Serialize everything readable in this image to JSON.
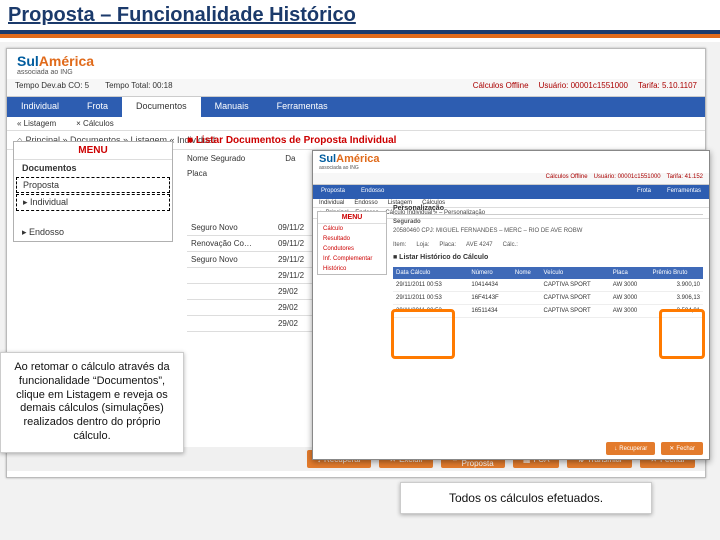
{
  "title": "Proposta – Funcionalidade Histórico",
  "brand": {
    "name_a": "Sul",
    "name_b": "América",
    "sub": "associada ao ING"
  },
  "back": {
    "top": {
      "tempo_dev": "Tempo Dev.ab CO: 5",
      "tempo_total": "Tempo Total: 00:18",
      "calc": "Cálculos Offline",
      "usuario": "Usuário: 00001c1551000",
      "tarifa": "Tarifa: 5.10.1107"
    },
    "tabs": [
      "Individual",
      "Frota",
      "Documentos",
      "Manuais",
      "Ferramentas"
    ],
    "subtabs": [
      "« Listagem",
      "× Cálculos"
    ],
    "crumb": "Principal » Documentos » Listagem « Individual",
    "menu": {
      "title": "MENU",
      "doc": "Documentos",
      "prop": "Proposta",
      "ind": "▸ Individual",
      "end": "▸ Endosso"
    },
    "listing_hd": "■ Listar Documentos de Proposta Individual",
    "labels": {
      "nome": "Nome Segurado",
      "da": "Da",
      "placa": "Placa"
    },
    "cols": [
      "",
      ""
    ],
    "rows": [
      [
        "Seguro Novo",
        "09/11/2"
      ],
      [
        "Renovação Co…",
        "09/11/2"
      ],
      [
        "Seguro Novo",
        "29/11/2"
      ],
      [
        "",
        "29/11/2"
      ],
      [
        "",
        "29/02"
      ],
      [
        "",
        "29/02"
      ],
      [
        "",
        "29/02"
      ]
    ],
    "actions": [
      "Recuperar",
      "Excluir",
      "Imprimir Proposta",
      "FCA",
      "Transmitir",
      "Fechar"
    ]
  },
  "front": {
    "top": {
      "calc": "Cálculos Offline",
      "usuario": "Usuário: 00001c1551000",
      "tarifa": "Tarifa: 41.152"
    },
    "tabs": [
      "Proposta",
      "Endosso",
      "",
      "",
      "Frota",
      "Ferramentas"
    ],
    "subtabs": [
      "Individual",
      "Endosso",
      "Listagem",
      "Cálculos"
    ],
    "crumb": "Principal » Endosso » Cálculo Individual » – Personalização",
    "menu": {
      "title": "MENU",
      "items": [
        "Cálculo",
        "Resultado",
        "Condutores",
        "Inf. Complementar",
        "Histórico"
      ]
    },
    "section": "Personalização",
    "seg_lbl": "Segurado",
    "seg_val": "20580460 CPJ: MIGUEL FERNANDES – MERC – RIO DE AVE ROBW",
    "pers": [
      "Item:",
      "Loja:",
      "Placa:",
      "AVE 4247",
      "Cálc.:"
    ],
    "hist_title": "■ Listar Histórico do Cálculo",
    "cols": [
      "Data Cálculo",
      "Número",
      "Nome",
      "Veículo",
      "Placa",
      "Prêmio Bruto"
    ],
    "rows": [
      [
        "29/11/2011 00:53",
        "10414434",
        "",
        "CAPTIVA SPORT",
        "AW 3000",
        "3.900,10"
      ],
      [
        "29/11/2011 00:53",
        "16F4143F",
        "",
        "CAPTIVA SPORT",
        "AW 3000",
        "3.906,13"
      ],
      [
        "29/11/2011 00:53…",
        "16511434",
        "",
        "CAPTIVA SPORT",
        "AW 3000",
        "3.594,01"
      ]
    ],
    "actions": [
      "Recuperar",
      "Fechar"
    ]
  },
  "callout1": "Ao retomar o cálculo através da funcionalidade “Documentos”, clique em Listagem e reveja os demais cálculos (simulações) realizados dentro do próprio cálculo.",
  "callout2": "Todos os cálculos efetuados."
}
